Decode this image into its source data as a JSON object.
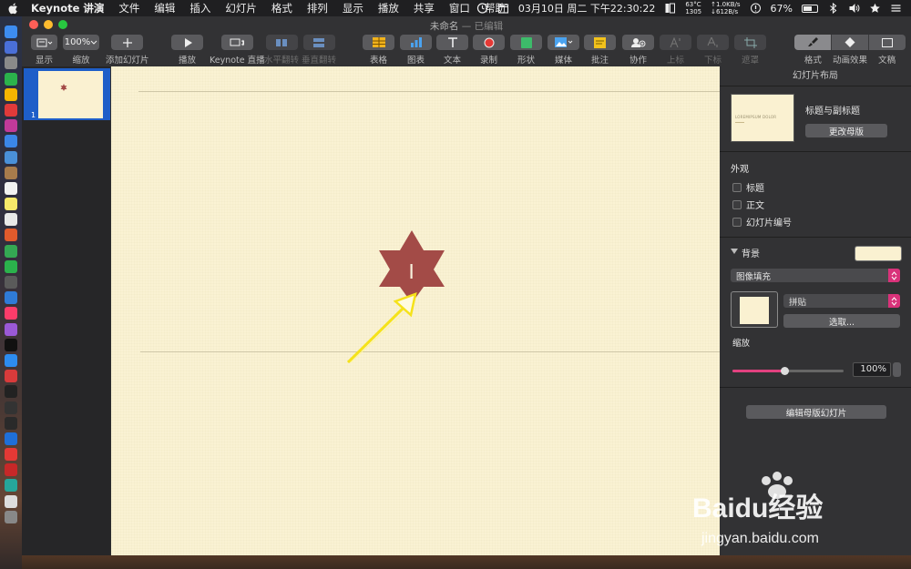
{
  "menubar": {
    "app_name": "Keynote 讲演",
    "items": [
      "文件",
      "编辑",
      "插入",
      "幻灯片",
      "格式",
      "排列",
      "显示",
      "播放",
      "共享",
      "窗口",
      "帮助"
    ],
    "status": {
      "date_time": "03月10日 周二 下午22:30:22",
      "temp": "63°C",
      "rpm": "1305",
      "net_up": "↑1.0KB/s",
      "net_down": "↓612B/s",
      "battery": "67%",
      "battery_level": 0.67
    }
  },
  "window": {
    "title": "未命名",
    "edited": "— 已编辑"
  },
  "toolbar": {
    "view": "显示",
    "zoom_value": "100%",
    "zoom": "缩放",
    "add_slide": "添加幻灯片",
    "play": "播放",
    "keynote_live": "Keynote 直播",
    "flip_h": "水平翻转",
    "flip_v": "垂直翻转",
    "table": "表格",
    "chart": "图表",
    "text": "文本",
    "record": "录制",
    "shape": "形状",
    "media": "媒体",
    "comment": "批注",
    "collaborate": "协作",
    "superscript": "上标",
    "subscript": "下标",
    "mask": "遮罩",
    "format": "格式",
    "animate": "动画效果",
    "document": "文稿"
  },
  "navigator": {
    "slide_number": "1"
  },
  "inspector": {
    "header": "幻灯片布局",
    "layout_name": "标题与副标题",
    "layout_thumb_text": "LOREMIPSUM DOLOR",
    "change_master": "更改母版",
    "appearance": "外观",
    "checkbox_title": "标题",
    "checkbox_body": "正文",
    "checkbox_slide_number": "幻灯片编号",
    "background": "背景",
    "fill_type": "图像填充",
    "tile_mode": "拼贴",
    "choose": "选取...",
    "scale": "缩放",
    "scale_value": "100%",
    "scale_fraction": 0.47,
    "edit_master": "编辑母版幻灯片"
  },
  "watermark": {
    "brand": "Baidu经验",
    "url": "jingyan.baidu.com"
  },
  "colors": {
    "slide_bg": "#faf2d3",
    "star": "#a34b47",
    "arrow": "#f5e21a",
    "accent": "#d9327a"
  }
}
